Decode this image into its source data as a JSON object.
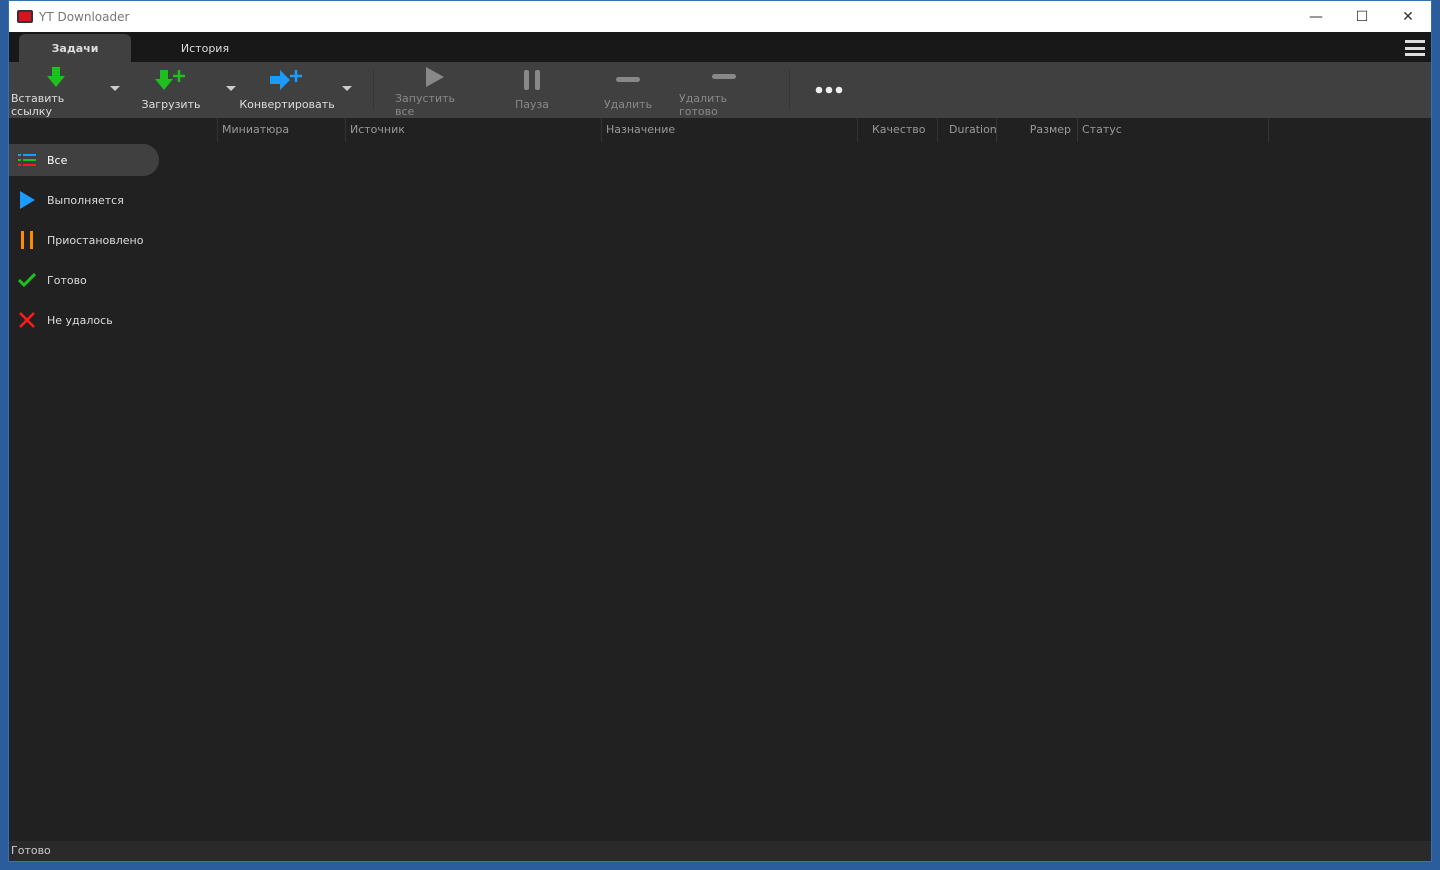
{
  "window": {
    "title": "YT Downloader"
  },
  "tabs": [
    {
      "label": "Задачи"
    },
    {
      "label": "История"
    }
  ],
  "toolbar": {
    "paste": "Вставить ссылку",
    "download": "Загрузить",
    "convert": "Конвертировать",
    "start_all": "Запустить все",
    "pause": "Пауза",
    "delete": "Удалить",
    "delete_done": "Удалить готово"
  },
  "columns": [
    "Миниатюра",
    "Источник",
    "Назначение",
    "Качество",
    "Duration",
    "Размер",
    "Статус"
  ],
  "sidebar": {
    "items": [
      {
        "label": "Все"
      },
      {
        "label": "Выполняется"
      },
      {
        "label": "Приостановлено"
      },
      {
        "label": "Готово"
      },
      {
        "label": "Не удалось"
      }
    ]
  },
  "status_bar": {
    "text": "Готово"
  },
  "colors": {
    "green": "#1ec01e",
    "blue": "#1a9cff",
    "orange": "#ff8a00",
    "red": "#ff1a1a"
  }
}
